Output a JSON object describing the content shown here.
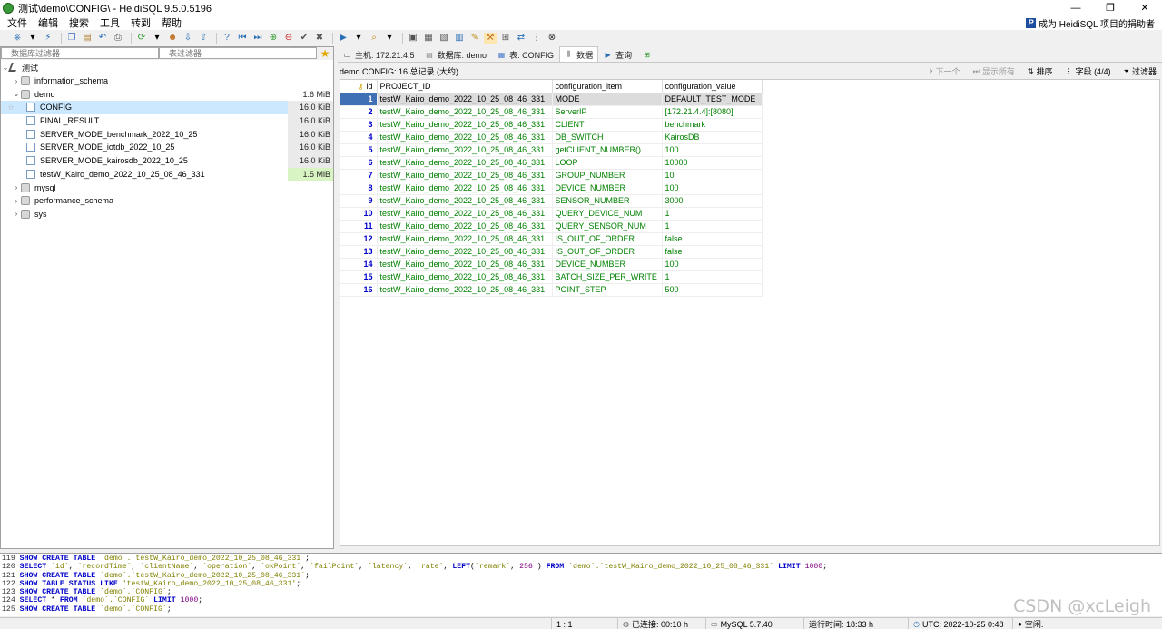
{
  "window": {
    "title": "测试\\demo\\CONFIG\\ - HeidiSQL 9.5.0.5196",
    "min": "—",
    "max": "❐",
    "close": "✕"
  },
  "menu": [
    "文件",
    "编辑",
    "搜索",
    "工具",
    "转到",
    "帮助"
  ],
  "donate_label": "成为 HeidiSQL 项目的捐助者",
  "toolbar_icons": [
    "connect-icon",
    "dropdown-icon",
    "disconnect-icon",
    "copy-icon",
    "paste-icon",
    "undo-icon",
    "print-icon",
    "refresh-icon",
    "user-icon",
    "import-icon",
    "export-icon",
    "help-icon",
    "first-icon",
    "last-icon",
    "add-icon",
    "delete-icon",
    "apply-icon",
    "cancel-icon",
    "run-icon",
    "find-icon",
    "save-icon",
    "load-icon",
    "sql-icon",
    "bookmark-icon",
    "highlight-icon",
    "tool-icon",
    "plugin-icon",
    "stop-icon"
  ],
  "filters": {
    "db_placeholder": "数据库过滤器",
    "table_placeholder": "表过滤器"
  },
  "tree": {
    "root": "测试",
    "items": [
      {
        "label": "information_schema",
        "size": ""
      },
      {
        "label": "demo",
        "size": "1.6 MiB"
      },
      {
        "label": "CONFIG",
        "size": "16.0 KiB"
      },
      {
        "label": "FINAL_RESULT",
        "size": "16.0 KiB"
      },
      {
        "label": "SERVER_MODE_benchmark_2022_10_25",
        "size": "16.0 KiB"
      },
      {
        "label": "SERVER_MODE_iotdb_2022_10_25",
        "size": "16.0 KiB"
      },
      {
        "label": "SERVER_MODE_kairosdb_2022_10_25",
        "size": "16.0 KiB"
      },
      {
        "label": "testW_Kairo_demo_2022_10_25_08_46_331",
        "size": "1.5 MiB"
      },
      {
        "label": "mysql",
        "size": ""
      },
      {
        "label": "performance_schema",
        "size": ""
      },
      {
        "label": "sys",
        "size": ""
      }
    ]
  },
  "tabs": [
    {
      "label": "主机: 172.21.4.5"
    },
    {
      "label": "数据库: demo"
    },
    {
      "label": "表: CONFIG"
    },
    {
      "label": "数据"
    },
    {
      "label": "查询"
    },
    {
      "label": ""
    }
  ],
  "grid": {
    "info": "demo.CONFIG: 16 总记录 (大约)",
    "next_label": "下一个",
    "show_all_label": "显示所有",
    "sort_label": "排序",
    "fields_label": "字段 (4/4)",
    "filter_label": "过滤器",
    "columns": [
      "id",
      "PROJECT_ID",
      "configuration_item",
      "configuration_value"
    ],
    "rows": [
      [
        "1",
        "testW_Kairo_demo_2022_10_25_08_46_331",
        "MODE",
        "DEFAULT_TEST_MODE"
      ],
      [
        "2",
        "testW_Kairo_demo_2022_10_25_08_46_331",
        "ServerIP",
        "[172.21.4.4]:[8080]"
      ],
      [
        "3",
        "testW_Kairo_demo_2022_10_25_08_46_331",
        "CLIENT",
        "benchmark"
      ],
      [
        "4",
        "testW_Kairo_demo_2022_10_25_08_46_331",
        "DB_SWITCH",
        "KairosDB"
      ],
      [
        "5",
        "testW_Kairo_demo_2022_10_25_08_46_331",
        "getCLIENT_NUMBER()",
        "100"
      ],
      [
        "6",
        "testW_Kairo_demo_2022_10_25_08_46_331",
        "LOOP",
        "10000"
      ],
      [
        "7",
        "testW_Kairo_demo_2022_10_25_08_46_331",
        "GROUP_NUMBER",
        "10"
      ],
      [
        "8",
        "testW_Kairo_demo_2022_10_25_08_46_331",
        "DEVICE_NUMBER",
        "100"
      ],
      [
        "9",
        "testW_Kairo_demo_2022_10_25_08_46_331",
        "SENSOR_NUMBER",
        "3000"
      ],
      [
        "10",
        "testW_Kairo_demo_2022_10_25_08_46_331",
        "QUERY_DEVICE_NUM",
        "1"
      ],
      [
        "11",
        "testW_Kairo_demo_2022_10_25_08_46_331",
        "QUERY_SENSOR_NUM",
        "1"
      ],
      [
        "12",
        "testW_Kairo_demo_2022_10_25_08_46_331",
        "IS_OUT_OF_ORDER",
        "false"
      ],
      [
        "13",
        "testW_Kairo_demo_2022_10_25_08_46_331",
        "IS_OUT_OF_ORDER",
        "false"
      ],
      [
        "14",
        "testW_Kairo_demo_2022_10_25_08_46_331",
        "DEVICE_NUMBER",
        "100"
      ],
      [
        "15",
        "testW_Kairo_demo_2022_10_25_08_46_331",
        "BATCH_SIZE_PER_WRITE",
        "1"
      ],
      [
        "16",
        "testW_Kairo_demo_2022_10_25_08_46_331",
        "POINT_STEP",
        "500"
      ]
    ]
  },
  "sql_log": [
    {
      "n": "119",
      "parts": [
        [
          "kw",
          "SHOW CREATE TABLE "
        ],
        [
          "str",
          "`demo`.`testW_Kairo_demo_2022_10_25_08_46_331`"
        ],
        [
          "",
          "; "
        ]
      ]
    },
    {
      "n": "120",
      "parts": [
        [
          "kw",
          "SELECT "
        ],
        [
          "str",
          "`id`"
        ],
        [
          "",
          ",  "
        ],
        [
          "str",
          "`recordTime`"
        ],
        [
          "",
          ",  "
        ],
        [
          "str",
          "`clientName`"
        ],
        [
          "",
          ",  "
        ],
        [
          "str",
          "`operation`"
        ],
        [
          "",
          ",  "
        ],
        [
          "str",
          "`okPoint`"
        ],
        [
          "",
          ",  "
        ],
        [
          "str",
          "`failPoint`"
        ],
        [
          "",
          ",  "
        ],
        [
          "str",
          "`latency`"
        ],
        [
          "",
          ",  "
        ],
        [
          "str",
          "`rate`"
        ],
        [
          "",
          ",  "
        ],
        [
          "kw",
          "LEFT"
        ],
        [
          "",
          "("
        ],
        [
          "str",
          "`remark`"
        ],
        [
          "",
          ", "
        ],
        [
          "num",
          "256"
        ],
        [
          "",
          " ) "
        ],
        [
          "kw",
          "FROM "
        ],
        [
          "str",
          "`demo`.`testW_Kairo_demo_2022_10_25_08_46_331`"
        ],
        [
          "kw",
          " LIMIT "
        ],
        [
          "num",
          "1000"
        ],
        [
          "",
          ";"
        ]
      ]
    },
    {
      "n": "121",
      "parts": [
        [
          "kw",
          "SHOW CREATE TABLE "
        ],
        [
          "str",
          "`demo`.`testW_Kairo_demo_2022_10_25_08_46_331`"
        ],
        [
          "",
          ";"
        ]
      ]
    },
    {
      "n": "122",
      "parts": [
        [
          "kw",
          "SHOW TABLE STATUS LIKE "
        ],
        [
          "str",
          "'testW_Kairo_demo_2022_10_25_08_46_331'"
        ],
        [
          "",
          ";"
        ]
      ]
    },
    {
      "n": "123",
      "parts": [
        [
          "kw",
          "SHOW CREATE TABLE "
        ],
        [
          "str",
          "`demo`.`CONFIG`"
        ],
        [
          "",
          ";"
        ]
      ]
    },
    {
      "n": "124",
      "parts": [
        [
          "kw",
          "SELECT "
        ],
        [
          "",
          " * "
        ],
        [
          "kw",
          "FROM "
        ],
        [
          "str",
          "`demo`.`CONFIG`"
        ],
        [
          "kw",
          " LIMIT "
        ],
        [
          "num",
          "1000"
        ],
        [
          "",
          ";"
        ]
      ]
    },
    {
      "n": "125",
      "parts": [
        [
          "kw",
          "SHOW CREATE TABLE "
        ],
        [
          "str",
          "`demo`.`CONFIG`"
        ],
        [
          "",
          ";"
        ]
      ]
    }
  ],
  "status": {
    "position": "1 : 1",
    "connected": "已连接: 00:10 h",
    "server": "MySQL 5.7.40",
    "uptime": "运行时间: 18:33 h",
    "utc": "UTC: 2022-10-25 0:48",
    "idle": "空闲."
  },
  "watermark": "CSDN @xcLeigh"
}
